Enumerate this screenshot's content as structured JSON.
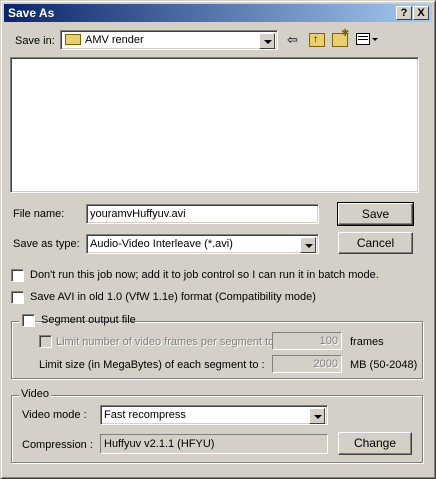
{
  "window": {
    "title": "Save As",
    "help_button": "?",
    "close_button": "X"
  },
  "save_in": {
    "label": "Save in:",
    "value": "AMV render"
  },
  "file_name": {
    "label": "File name:",
    "value": "youramvHuffyuv.avi"
  },
  "save_as_type": {
    "label": "Save as type:",
    "value": "Audio-Video Interleave (*.avi)"
  },
  "buttons": {
    "save": "Save",
    "cancel": "Cancel",
    "change": "Change"
  },
  "options": {
    "batch_mode": "Don't run this job now; add it to job control so I can run it in batch mode.",
    "old_avi": "Save AVI in old 1.0 (VfW 1.1e) format (Compatibility mode)"
  },
  "segment": {
    "label": "Segment output file",
    "limit_frames_label": "Limit number of video frames per segment to",
    "limit_frames_value": "100",
    "limit_frames_unit": "frames",
    "limit_size_label": "Limit size (in MegaBytes) of each segment to :",
    "limit_size_value": "2000",
    "limit_size_unit": "MB (50-2048)"
  },
  "video": {
    "group_label": "Video",
    "mode_label": "Video mode :",
    "mode_value": "Fast recompress",
    "compression_label": "Compression :",
    "compression_value": "Huffyuv v2.1.1 (HFYU)"
  }
}
